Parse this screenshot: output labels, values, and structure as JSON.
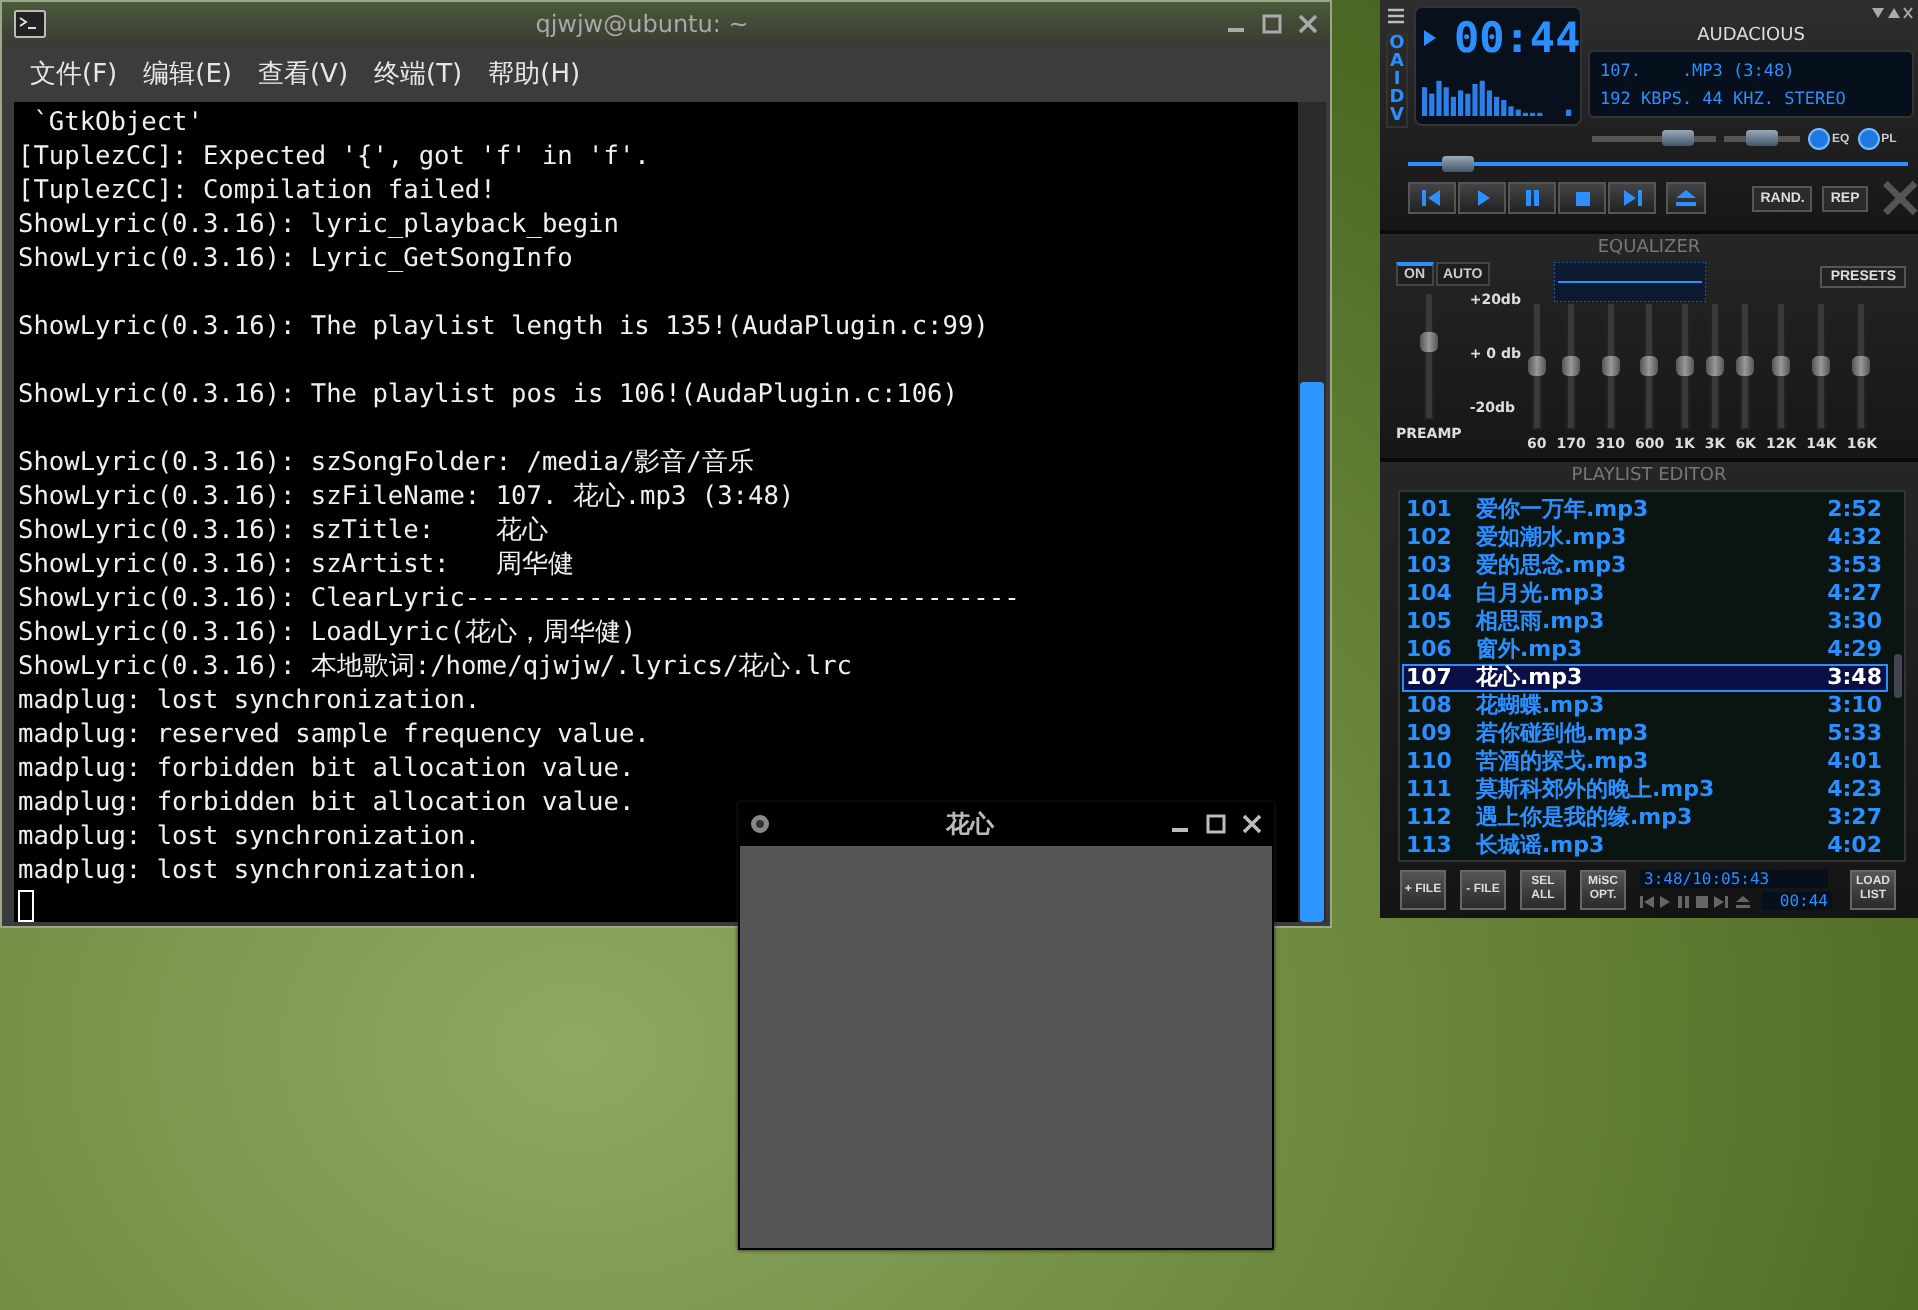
{
  "terminal": {
    "title": "qjwjw@ubuntu: ~",
    "menu": [
      {
        "label": "文件(F)"
      },
      {
        "label": "编辑(E)"
      },
      {
        "label": "查看(V)"
      },
      {
        "label": "终端(T)"
      },
      {
        "label": "帮助(H)"
      }
    ],
    "blocks": [
      [
        " `GtkObject'",
        "[TuplezCC]: Expected '{', got 'f' in 'f'.",
        "[TuplezCC]: Compilation failed!",
        "ShowLyric(0.3.16): lyric_playback_begin",
        "ShowLyric(0.3.16): Lyric_GetSongInfo"
      ],
      [
        "ShowLyric(0.3.16): The playlist length is 135!(AudaPlugin.c:99)"
      ],
      [
        "ShowLyric(0.3.16): The playlist pos is 106!(AudaPlugin.c:106)"
      ],
      [
        "ShowLyric(0.3.16): szSongFolder: /media/影音/音乐",
        "ShowLyric(0.3.16): szFileName: 107. 花心.mp3 (3:48)",
        "ShowLyric(0.3.16): szTitle:    花心",
        "ShowLyric(0.3.16): szArtist:   周华健",
        "ShowLyric(0.3.16): ClearLyric------------------------------------",
        "ShowLyric(0.3.16): LoadLyric(花心，周华健)",
        "ShowLyric(0.3.16): 本地歌词:/home/qjwjw/.lyrics/花心.lrc",
        "madplug: lost synchronization.",
        "madplug: reserved sample frequency value.",
        "madplug: forbidden bit allocation value.",
        "madplug: forbidden bit allocation value.",
        "madplug: lost synchronization.",
        "madplug: lost synchronization."
      ]
    ]
  },
  "player": {
    "clutterbar": "OAIDV",
    "title": "AUDACIOUS",
    "time": "00:44",
    "song_info": "107.    .MP3 (3:48)",
    "stream_info": "192 KBPS. 44 KHZ. STEREO",
    "volume": {
      "level": 0.7
    },
    "balance": {
      "level": 0.5
    },
    "seek": {
      "level": 0.1
    },
    "eq_toggle": {
      "label": "EQ",
      "on": true
    },
    "pl_toggle": {
      "label": "PL",
      "on": true
    },
    "shuffle": {
      "label": "RAND.",
      "on": false
    },
    "repeat": {
      "label": "REP",
      "on": false
    }
  },
  "equalizer": {
    "title": "EQUALIZER",
    "on_toggle": {
      "label": "ON",
      "on": true
    },
    "auto_toggle": {
      "label": "AUTO",
      "on": false
    },
    "presets": "PRESETS",
    "scale": [
      "+20db",
      "+ 0 db",
      "-20db"
    ],
    "preamp": {
      "label": "PREAMP",
      "level": 0.62
    },
    "bands": [
      {
        "label": "60",
        "level": 0.5
      },
      {
        "label": "170",
        "level": 0.5
      },
      {
        "label": "310",
        "level": 0.5
      },
      {
        "label": "600",
        "level": 0.5
      },
      {
        "label": "1K",
        "level": 0.5
      },
      {
        "label": "3K",
        "level": 0.5
      },
      {
        "label": "6K",
        "level": 0.5
      },
      {
        "label": "12K",
        "level": 0.5
      },
      {
        "label": "14K",
        "level": 0.5
      },
      {
        "label": "16K",
        "level": 0.5
      }
    ]
  },
  "playlist": {
    "title": "PLAYLIST EDITOR",
    "rows": [
      {
        "number": "101",
        "title": "爱你一万年.mp3",
        "length": "2:52",
        "selected": false
      },
      {
        "number": "102",
        "title": "爱如潮水.mp3",
        "length": "4:32",
        "selected": false
      },
      {
        "number": "103",
        "title": "爱的思念.mp3",
        "length": "3:53",
        "selected": false
      },
      {
        "number": "104",
        "title": "白月光.mp3",
        "length": "4:27",
        "selected": false
      },
      {
        "number": "105",
        "title": "相思雨.mp3",
        "length": "3:30",
        "selected": false
      },
      {
        "number": "106",
        "title": "窗外.mp3",
        "length": "4:29",
        "selected": false
      },
      {
        "number": "107",
        "title": "花心.mp3",
        "length": "3:48",
        "selected": true
      },
      {
        "number": "108",
        "title": "花蝴蝶.mp3",
        "length": "3:10",
        "selected": false
      },
      {
        "number": "109",
        "title": "若你碰到他.mp3",
        "length": "5:33",
        "selected": false
      },
      {
        "number": "110",
        "title": "苦酒的探戈.mp3",
        "length": "4:01",
        "selected": false
      },
      {
        "number": "111",
        "title": "莫斯科郊外的晚上.mp3",
        "length": "4:23",
        "selected": false
      },
      {
        "number": "112",
        "title": "遇上你是我的缘.mp3",
        "length": "3:27",
        "selected": false
      },
      {
        "number": "113",
        "title": "长城谣.mp3",
        "length": "4:02",
        "selected": false
      }
    ],
    "buttons": [
      {
        "label": "+ FILE"
      },
      {
        "label": "- FILE"
      },
      {
        "label": "SEL ALL"
      },
      {
        "label": "MiSC OPT."
      }
    ],
    "total_time": "3:48/10:05:43",
    "time": "00:44",
    "load_button": "LOAD LIST"
  },
  "popup": {
    "title": "花心"
  }
}
